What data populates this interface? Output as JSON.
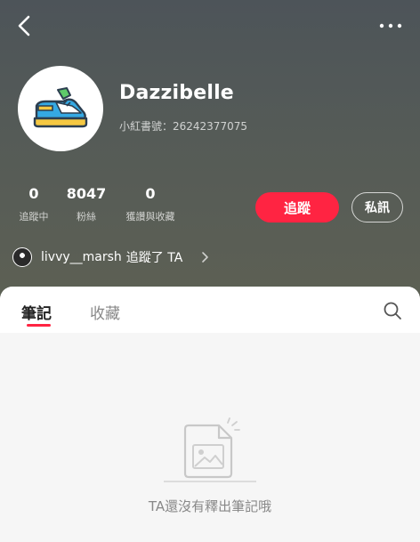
{
  "profile": {
    "name": "Dazzibelle",
    "id_text": "小紅書號：26242377075"
  },
  "stats": [
    {
      "value": "0",
      "label": "追蹤中"
    },
    {
      "value": "8047",
      "label": "粉絲"
    },
    {
      "value": "0",
      "label": "獲讚與收藏"
    }
  ],
  "actions": {
    "follow": "追蹤",
    "message": "私訊"
  },
  "followed_by": {
    "user": "livvy__marsh",
    "text": "追蹤了 TA"
  },
  "tabs": [
    {
      "label": "筆記",
      "active": true
    },
    {
      "label": "收藏",
      "active": false
    }
  ],
  "empty_state": {
    "text": "TA還沒有釋出筆記哦"
  },
  "colors": {
    "accent": "#ff2442",
    "header_top": "#4d5459",
    "header_bottom": "#5d6054"
  },
  "icons": [
    "back-icon",
    "more-icon",
    "shoe-avatar-icon",
    "chevron-right-icon",
    "search-icon",
    "empty-note-icon"
  ]
}
